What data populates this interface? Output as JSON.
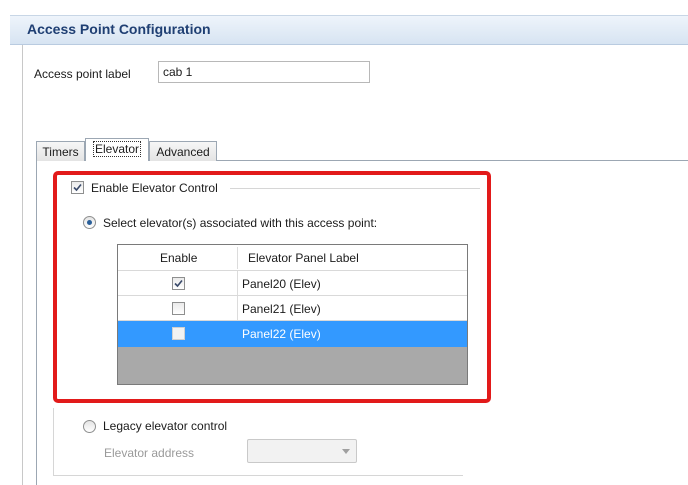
{
  "header": {
    "title": "Access Point Configuration"
  },
  "access_point": {
    "label": "Access point label",
    "value": "cab 1"
  },
  "tabs": [
    {
      "label": "Timers",
      "active": false
    },
    {
      "label": "Elevator",
      "active": true
    },
    {
      "label": "Advanced",
      "active": false
    }
  ],
  "elevator": {
    "enable_label": "Enable Elevator Control",
    "enable_checked": true,
    "select_radio_label": "Select elevator(s) associated with this access point:",
    "table": {
      "headers": [
        "Enable",
        "Elevator Panel Label"
      ],
      "rows": [
        {
          "enabled": true,
          "label": "Panel20 (Elev)",
          "selected": false
        },
        {
          "enabled": false,
          "label": "Panel21 (Elev)",
          "selected": false
        },
        {
          "enabled": false,
          "label": "Panel22 (Elev)",
          "selected": true
        }
      ]
    },
    "legacy_label": "Legacy elevator control",
    "address_label": "Elevator address",
    "address_value": ""
  },
  "colors": {
    "highlight": "#e21a1a",
    "selection": "#3399ff",
    "header_text": "#1f3f73"
  },
  "icons": {
    "checkbox_check": "check-icon",
    "dropdown_arrow": "chevron-down-icon"
  }
}
